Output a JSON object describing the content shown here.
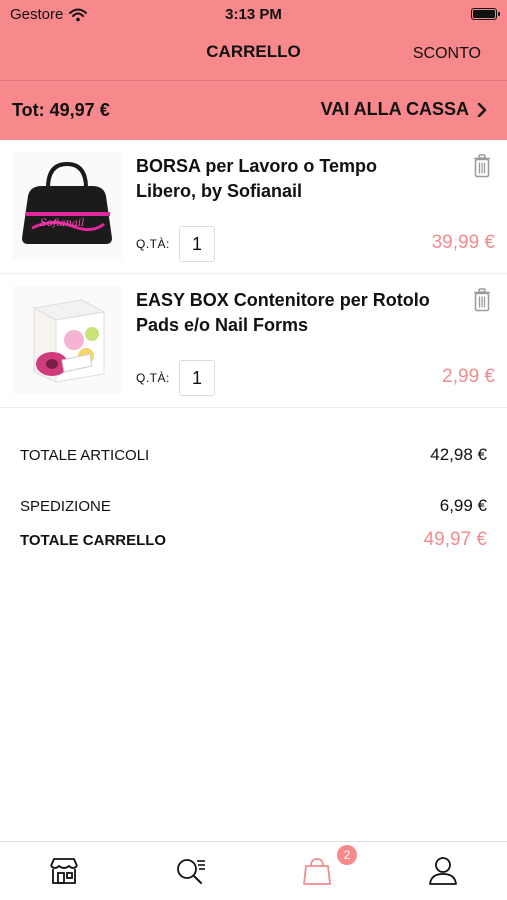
{
  "status_bar": {
    "carrier": "Gestore",
    "time": "3:13 PM"
  },
  "nav": {
    "title": "CARRELLO",
    "right_action": "SCONTO"
  },
  "checkout_bar": {
    "total": "Tot: 49,97 €",
    "action": "VAI ALLA CASSA"
  },
  "cart": {
    "items": [
      {
        "title": "BORSA per Lavoro o Tempo Libero, by Sofianail",
        "qty_label": "Q.TÀ:",
        "qty": "1",
        "price": "39,99 €",
        "thumb_text": "Sofianail"
      },
      {
        "title": "EASY BOX Contenitore per Rotolo Pads e/o Nail Forms",
        "qty_label": "Q.TÀ:",
        "qty": "1",
        "price": "2,99 €"
      }
    ]
  },
  "summary": {
    "items_label": "TOTALE ARTICOLI",
    "items_value": "42,98 €",
    "shipping_label": "SPEDIZIONE",
    "shipping_value": "6,99 €",
    "cart_label": "TOTALE CARRELLO",
    "cart_value": "49,97 €"
  },
  "tabbar": {
    "cart_badge": "2"
  },
  "colors": {
    "brand": "#f7888b",
    "price": "#f28b8f",
    "active_tab": "#f28b8f"
  },
  "icons": [
    "wifi-icon",
    "battery-icon",
    "chevron-right-icon",
    "trash-icon",
    "store-icon",
    "search-list-icon",
    "shopping-bag-icon",
    "user-icon"
  ]
}
